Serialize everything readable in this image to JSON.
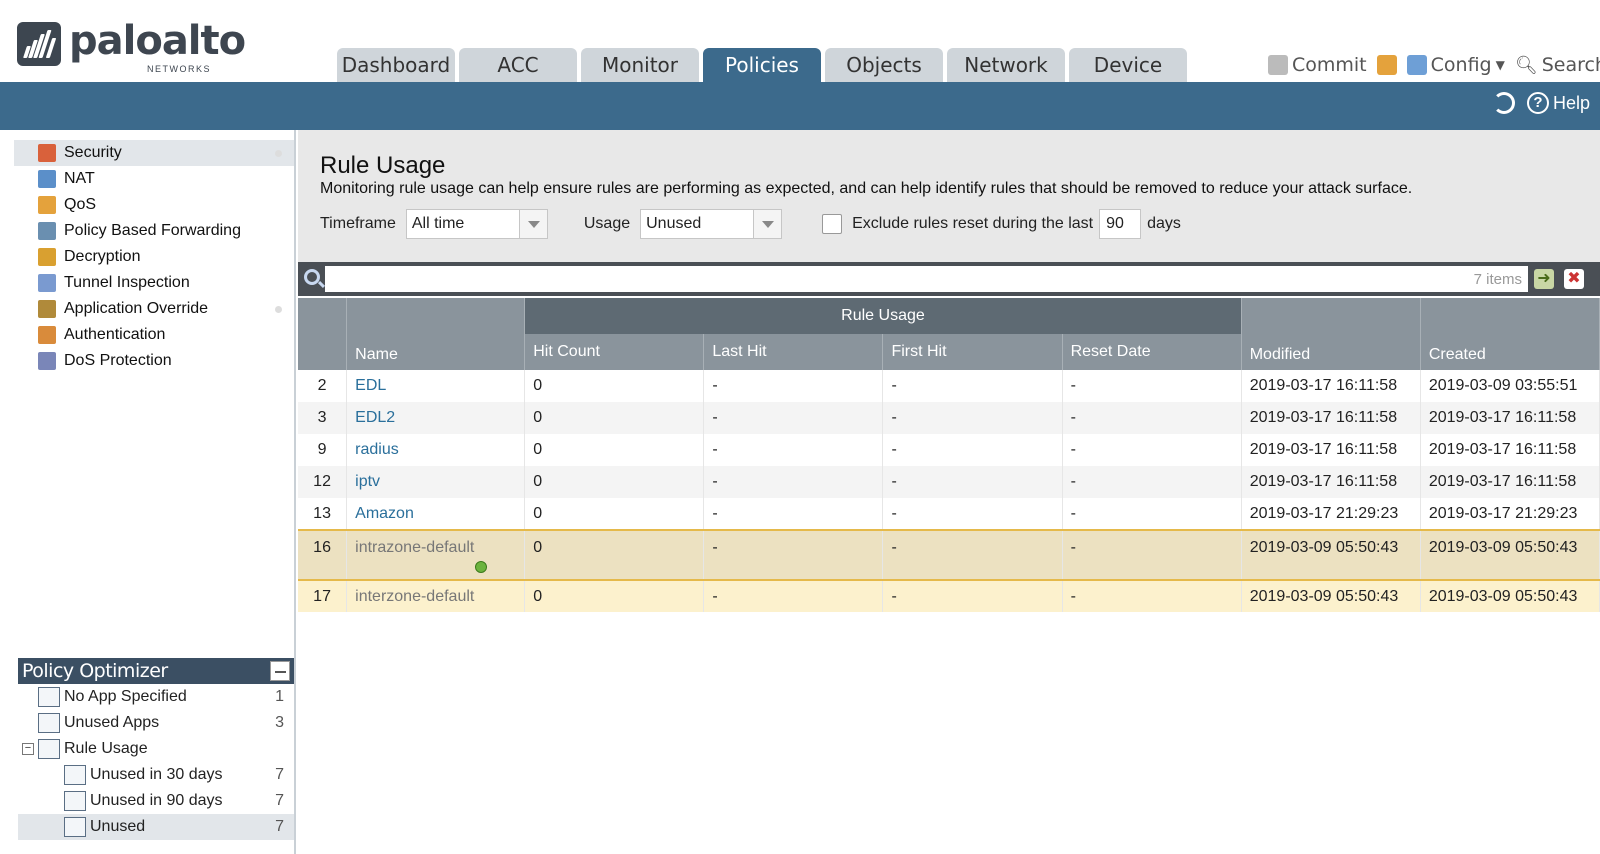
{
  "brand": {
    "name": "paloalto",
    "sub": "NETWORKS"
  },
  "tabs": [
    "Dashboard",
    "ACC",
    "Monitor",
    "Policies",
    "Objects",
    "Network",
    "Device"
  ],
  "active_tab": "Policies",
  "header_actions": {
    "commit": "Commit",
    "config": "Config",
    "search": "Search",
    "help": "Help"
  },
  "sidebar": {
    "items": [
      {
        "label": "Security",
        "icon": "firewall-icon",
        "color": "#d9613b"
      },
      {
        "label": "NAT",
        "icon": "nat-icon",
        "color": "#5b8fc9"
      },
      {
        "label": "QoS",
        "icon": "qos-icon",
        "color": "#e4a23c"
      },
      {
        "label": "Policy Based Forwarding",
        "icon": "pbf-icon",
        "color": "#6a8fb0"
      },
      {
        "label": "Decryption",
        "icon": "lock-icon",
        "color": "#d9a030"
      },
      {
        "label": "Tunnel Inspection",
        "icon": "user-icon",
        "color": "#7a9ad0"
      },
      {
        "label": "Application Override",
        "icon": "grid-icon",
        "color": "#b08a3a"
      },
      {
        "label": "Authentication",
        "icon": "users-icon",
        "color": "#d98b3b"
      },
      {
        "label": "DoS Protection",
        "icon": "shield-icon",
        "color": "#7a86b8"
      }
    ]
  },
  "optimizer": {
    "title": "Policy Optimizer",
    "items": [
      {
        "label": "No App Specified",
        "count": "1"
      },
      {
        "label": "Unused Apps",
        "count": "3"
      },
      {
        "label": "Rule Usage",
        "count": ""
      },
      {
        "label": "Unused in 30 days",
        "count": "7"
      },
      {
        "label": "Unused in 90 days",
        "count": "7"
      },
      {
        "label": "Unused",
        "count": "7"
      }
    ]
  },
  "rule_usage": {
    "title": "Rule Usage",
    "description": "Monitoring rule usage can help ensure rules are performing as expected, and can help identify rules that should be removed to reduce your attack surface.",
    "timeframe_label": "Timeframe",
    "timeframe_value": "All time",
    "usage_label": "Usage",
    "usage_value": "Unused",
    "exclude_label": "Exclude rules reset during the last",
    "exclude_days": "90",
    "days_label": "days"
  },
  "search": {
    "placeholder": "",
    "count_text": "7 items"
  },
  "table": {
    "group_header": "Rule Usage",
    "columns": [
      "",
      "Name",
      "Hit Count",
      "Last Hit",
      "First Hit",
      "Reset Date",
      "Modified",
      "Created"
    ],
    "rows": [
      [
        "2",
        "EDL",
        "0",
        "-",
        "-",
        "-",
        "2019-03-17 16:11:58",
        "2019-03-09 03:55:51"
      ],
      [
        "3",
        "EDL2",
        "0",
        "-",
        "-",
        "-",
        "2019-03-17 16:11:58",
        "2019-03-17 16:11:58"
      ],
      [
        "9",
        "radius",
        "0",
        "-",
        "-",
        "-",
        "2019-03-17 16:11:58",
        "2019-03-17 16:11:58"
      ],
      [
        "12",
        "iptv",
        "0",
        "-",
        "-",
        "-",
        "2019-03-17 16:11:58",
        "2019-03-17 16:11:58"
      ],
      [
        "13",
        "Amazon",
        "0",
        "-",
        "-",
        "-",
        "2019-03-17 21:29:23",
        "2019-03-17 21:29:23"
      ],
      [
        "16",
        "intrazone-default",
        "0",
        "-",
        "-",
        "-",
        "2019-03-09 05:50:43",
        "2019-03-09 05:50:43"
      ],
      [
        "17",
        "interzone-default",
        "0",
        "-",
        "-",
        "-",
        "2019-03-09 05:50:43",
        "2019-03-09 05:50:43"
      ]
    ]
  }
}
